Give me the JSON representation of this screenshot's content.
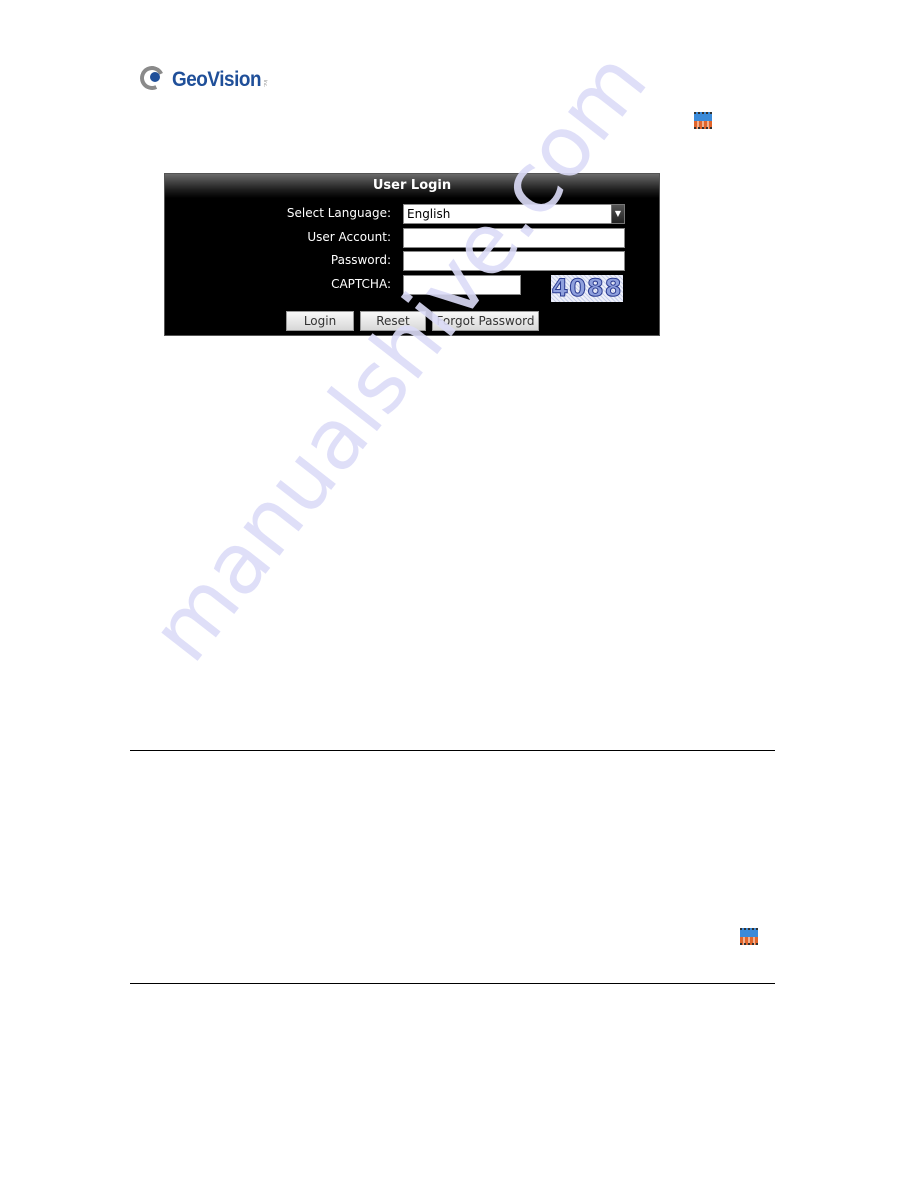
{
  "brand": {
    "name": "GeoVision",
    "suffix": "Inc.",
    "accent_color": "#1f4f99"
  },
  "icons": {
    "top_inline": "film-playback-icon",
    "bottom_inline": "film-playback-icon"
  },
  "login_panel": {
    "title": "User Login",
    "fields": {
      "language": {
        "label": "Select Language:",
        "value": "English"
      },
      "account": {
        "label": "User Account:",
        "value": "",
        "placeholder": ""
      },
      "password": {
        "label": "Password:",
        "value": "",
        "placeholder": ""
      },
      "captcha": {
        "label": "CAPTCHA:",
        "value": "",
        "placeholder": "",
        "image_text": "4088"
      }
    },
    "buttons": {
      "login": "Login",
      "reset": "Reset",
      "forgot_password": "Forgot Password"
    }
  },
  "watermark": "manualshive.com"
}
